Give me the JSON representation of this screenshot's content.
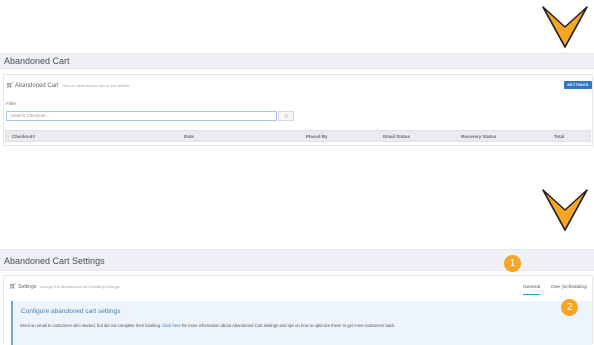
{
  "colors": {
    "accent_arrow": "#f6a623",
    "primary_button": "#2f78c4",
    "badge": "#f6a623",
    "tab_underline": "#1fa8c9"
  },
  "section1": {
    "page_title": "Abandoned Cart",
    "panel_title": "Abandoned Cart",
    "panel_hint": "click on abandoned cart to see details",
    "settings_button": "SETTINGS",
    "filter_label": "Filter",
    "search_placeholder": "Search Checkout...",
    "search_button": "Q",
    "columns": [
      "Checkout#",
      "Date",
      "Placed By",
      "Email Status",
      "Recovery Status",
      "Total"
    ]
  },
  "section2": {
    "page_title": "Abandoned Cart Settings",
    "panel_title": "Settings",
    "panel_hint": "change the abandoned cart emailing settings",
    "tabs": [
      {
        "label": "General"
      },
      {
        "label": "One (Scheduling"
      }
    ],
    "badges": [
      "1",
      "2"
    ],
    "info_heading": "Configure abandoned cart settings",
    "info_text_before": "Send an email to customers who started, but did not complete their booking. ",
    "info_link": "Click here",
    "info_text_after": " for more information about Abandoned Cart settings and tips on how to optimize these to get more customers back."
  },
  "icons": {
    "cart": "cart-icon",
    "arrow": "chevron-down-arrow-icon"
  }
}
